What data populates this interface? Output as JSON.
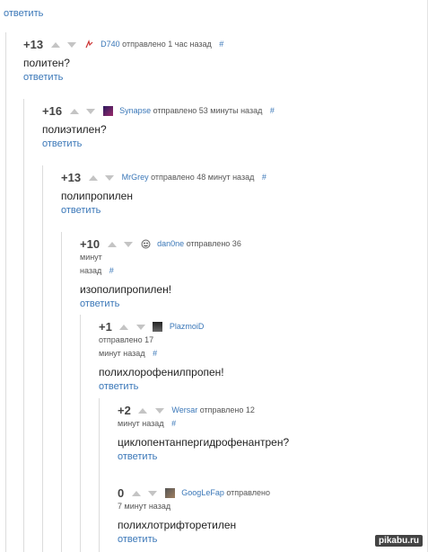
{
  "top_reply": "ответить",
  "comments": [
    {
      "score": "+13",
      "user": "D740",
      "sent": "отправлено 1 час назад",
      "hash": "#",
      "text": "политен?",
      "reply": "ответить",
      "avatar": "sign-icon"
    },
    {
      "score": "+16",
      "user": "Synapse",
      "sent": "отправлено 53 минуты назад",
      "hash": "#",
      "text": "полиэтилен?",
      "reply": "ответить",
      "avatar": "purple-avatar"
    },
    {
      "score": "+13",
      "user": "MrGrey",
      "sent": "отправлено 48 минут назад",
      "hash": "#",
      "text": "полипропилен",
      "reply": "ответить",
      "avatar": "none"
    },
    {
      "score": "+10",
      "user": "dan0ne",
      "sent1": "отправлено 36 минут",
      "sent2": "назад",
      "hash": "#",
      "text": "изополипропилен!",
      "reply": "ответить",
      "avatar": "face-icon"
    },
    {
      "score": "+1",
      "user": "PlazmoiD",
      "sent1": "отправлено 17",
      "sent2": "минут назад",
      "hash": "#",
      "text": "полихлорофенилпропен!",
      "reply": "ответить",
      "avatar": "dark-avatar"
    },
    {
      "score": "+2",
      "user": "Wersar",
      "sent1": "отправлено 12",
      "sent2": "минут назад",
      "hash": "#",
      "text": "циклопентанпергидрофенантрен?",
      "reply": "ответить",
      "avatar": "none"
    },
    {
      "score": "0",
      "user": "GoogLeFap",
      "sent1": "отправлено",
      "sent2": "7 минут назад",
      "hash": "#",
      "text": "полихлотрифторетилен",
      "reply": "ответить",
      "avatar": "photo-avatar"
    }
  ],
  "watermark": "pikabu.ru"
}
